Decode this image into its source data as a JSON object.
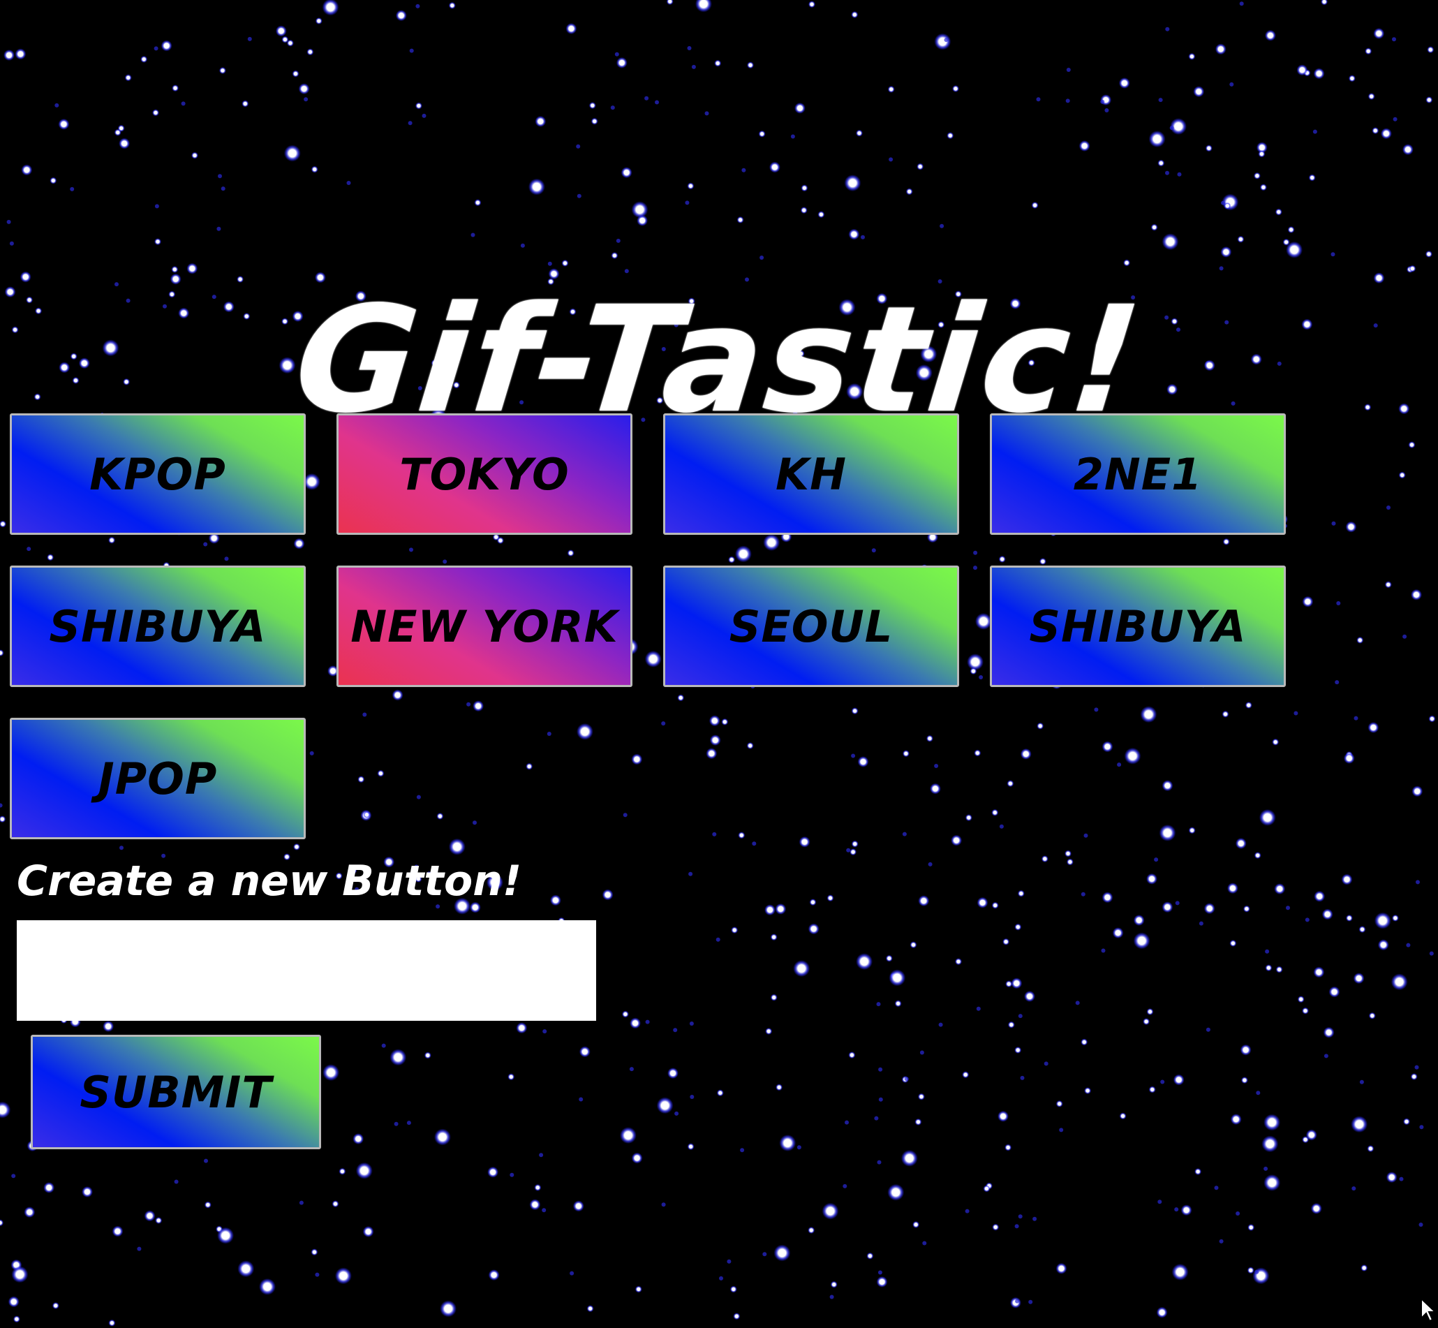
{
  "page": {
    "title": "Gif-Tastic!"
  },
  "topic_buttons": [
    {
      "label": "KPOP",
      "style": "green-blue"
    },
    {
      "label": "TOKYO",
      "style": "pink-purple"
    },
    {
      "label": "KH",
      "style": "green-blue"
    },
    {
      "label": "2NE1",
      "style": "green-blue"
    },
    {
      "label": "SHIBUYA",
      "style": "green-blue"
    },
    {
      "label": "NEW YORK",
      "style": "pink-purple"
    },
    {
      "label": "SEOUL",
      "style": "green-blue"
    },
    {
      "label": "SHIBUYA",
      "style": "green-blue"
    },
    {
      "label": "JPOP",
      "style": "green-blue"
    }
  ],
  "form": {
    "label": "Create a new Button!",
    "input_value": "",
    "input_placeholder": "",
    "submit_label": "SUBMIT"
  },
  "colors": {
    "background": "#000000",
    "star": "#ffffff",
    "star_glow": "#3a3aff",
    "gradient_green": "#7bf84a",
    "gradient_blue": "#001df2",
    "gradient_pink": "#e0348c",
    "gradient_red": "#ea3350",
    "button_border": "#b9b9b9"
  },
  "icons": {
    "mouse_pointer": "cursor-arrow-icon"
  }
}
